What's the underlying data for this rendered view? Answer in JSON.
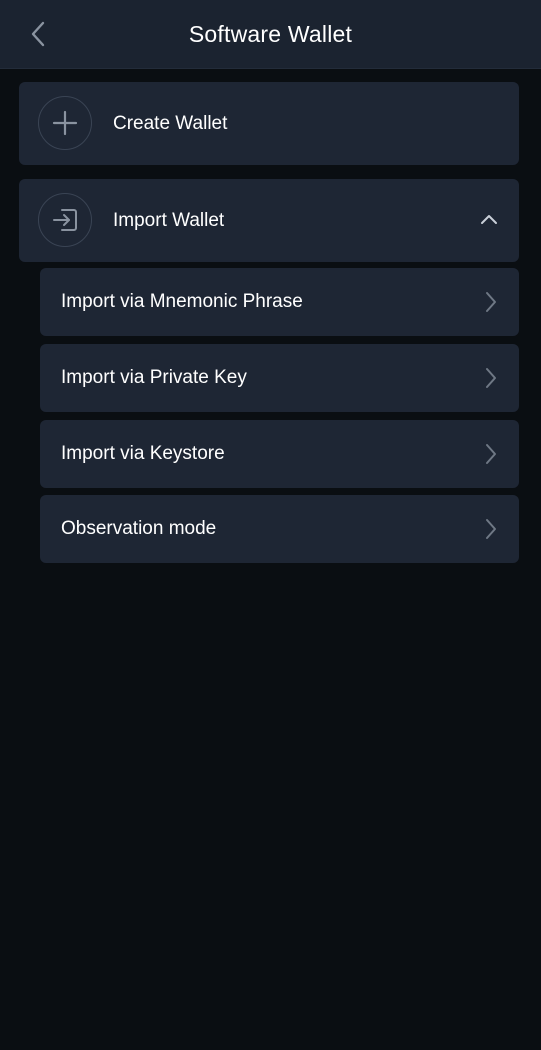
{
  "header": {
    "title": "Software Wallet",
    "back_icon": "chevron-left-icon"
  },
  "actions": {
    "create": {
      "label": "Create Wallet",
      "icon": "plus-icon"
    },
    "import": {
      "label": "Import Wallet",
      "icon": "import-icon",
      "expanded": true,
      "toggle_icon": "chevron-up-icon"
    }
  },
  "import_options": [
    {
      "label": "Import via Mnemonic Phrase",
      "icon": "chevron-right-icon"
    },
    {
      "label": "Import via Private Key",
      "icon": "chevron-right-icon"
    },
    {
      "label": "Import via Keystore",
      "icon": "chevron-right-icon"
    },
    {
      "label": "Observation mode",
      "icon": "chevron-right-icon"
    }
  ],
  "colors": {
    "background": "#0a0e12",
    "header": "#1b2330",
    "card": "#1e2634",
    "icon_muted": "#8a93a0",
    "text": "#ffffff"
  }
}
